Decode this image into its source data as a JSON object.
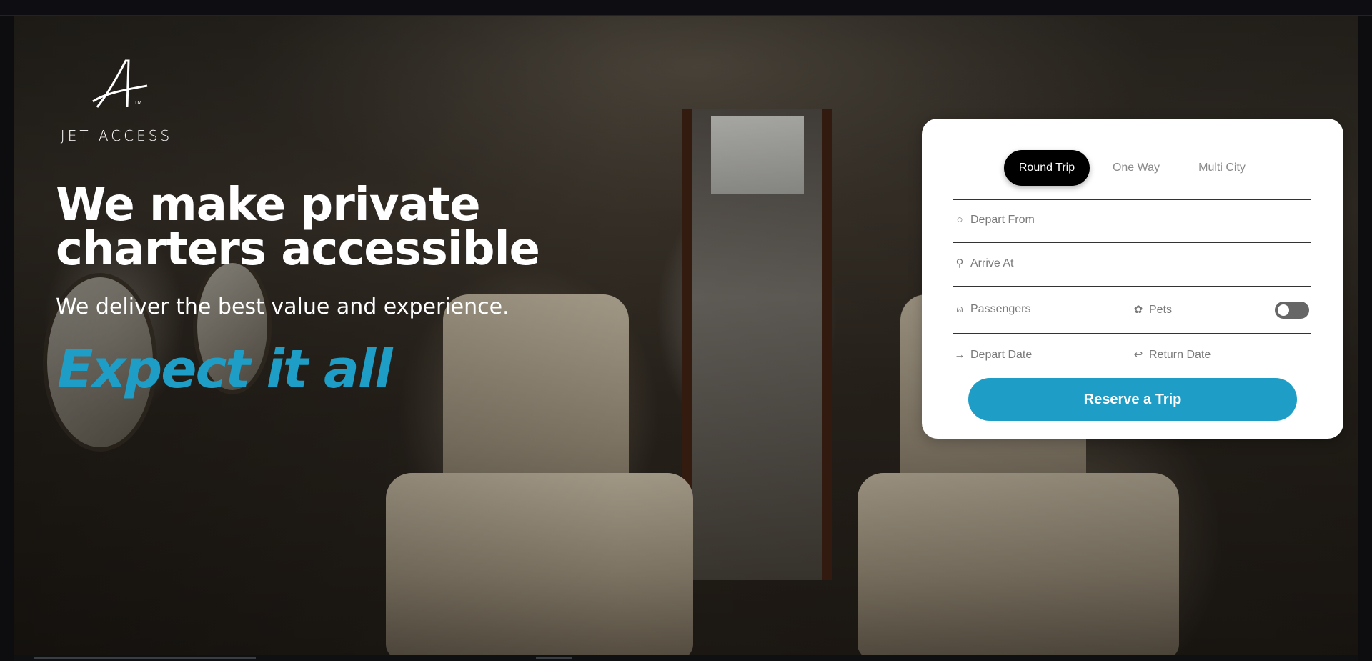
{
  "brand": {
    "name": "JET ACCESS",
    "logo_icon": "jet-access-logo-icon"
  },
  "hero": {
    "headline_line1": "We make private",
    "headline_line2": "charters accessible",
    "subline": "We deliver the best value and experience.",
    "tagline": "Expect it all"
  },
  "booking": {
    "tabs": [
      {
        "label": "Round Trip",
        "active": true
      },
      {
        "label": "One Way",
        "active": false
      },
      {
        "label": "Multi City",
        "active": false
      }
    ],
    "depart_from": {
      "placeholder": "Depart From",
      "icon": "circle-icon"
    },
    "arrive_at": {
      "placeholder": "Arrive At",
      "icon": "map-pin-icon"
    },
    "passengers": {
      "placeholder": "Passengers",
      "icon": "person-icon"
    },
    "pets": {
      "label": "Pets",
      "icon": "paw-icon",
      "enabled": false
    },
    "depart_date": {
      "placeholder": "Depart Date",
      "icon": "arrow-right-icon"
    },
    "return_date": {
      "placeholder": "Return Date",
      "icon": "return-arrow-icon"
    },
    "submit_label": "Reserve a Trip"
  },
  "colors": {
    "accent": "#1e9ec6",
    "active_tab": "#000000",
    "card": "#ffffff"
  }
}
